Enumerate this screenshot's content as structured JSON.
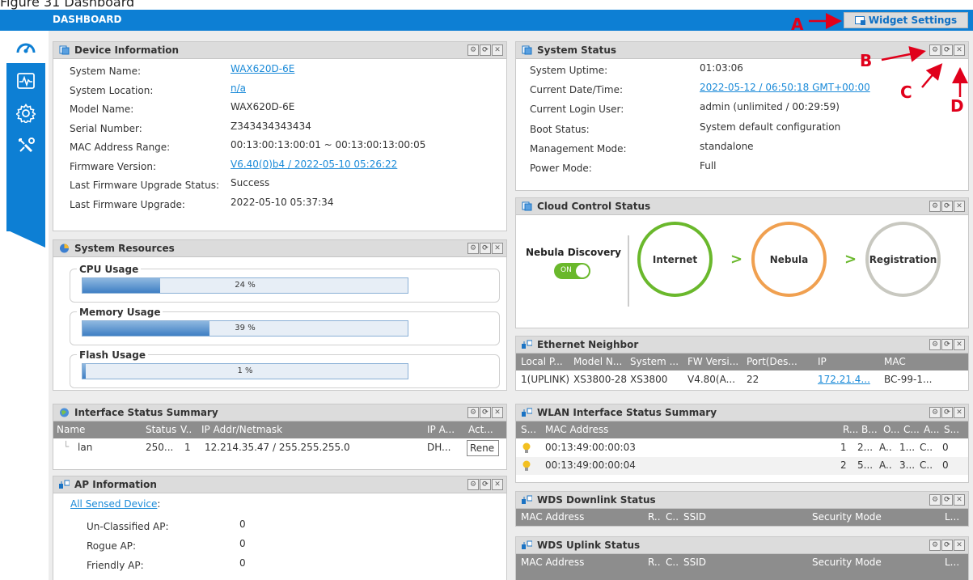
{
  "figure_caption": "Figure 31   Dashboard",
  "header": {
    "title": "DASHBOARD",
    "widget_settings": "Widget Settings"
  },
  "sidebar": {
    "items": [
      "dashboard-icon",
      "monitor-icon",
      "configuration-icon",
      "maintenance-icon"
    ]
  },
  "device_info": {
    "title": "Device Information",
    "rows": [
      {
        "label": "System Name:",
        "value": "WAX620D-6E",
        "link": true
      },
      {
        "label": "System Location:",
        "value": "n/a",
        "link": true
      },
      {
        "label": "Model Name:",
        "value": "WAX620D-6E",
        "link": false
      },
      {
        "label": "Serial Number:",
        "value": "Z343434343434",
        "link": false
      },
      {
        "label": "MAC Address Range:",
        "value": "00:13:00:13:00:01 ~ 00:13:00:13:00:05",
        "link": false
      },
      {
        "label": "Firmware Version:",
        "value": "V6.40(0)b4 / 2022-05-10 05:26:22",
        "link": true
      },
      {
        "label": "Last Firmware Upgrade Status:",
        "value": "Success",
        "link": false
      },
      {
        "label": "Last Firmware Upgrade:",
        "value": "2022-05-10 05:37:34",
        "link": false
      }
    ]
  },
  "system_resources": {
    "title": "System Resources",
    "bars": [
      {
        "label": "CPU Usage",
        "value": 24,
        "text": "24 %"
      },
      {
        "label": "Memory Usage",
        "value": 39,
        "text": "39 %"
      },
      {
        "label": "Flash Usage",
        "value": 1,
        "text": "1 %"
      }
    ]
  },
  "interface_status": {
    "title": "Interface Status Summary",
    "headers": [
      "Name",
      "Status",
      "V..",
      "IP Addr/Netmask",
      "IP A...",
      "Act..."
    ],
    "rows": [
      [
        "lan",
        "250...",
        "1",
        "12.214.35.47 / 255.255.255.0",
        "DH...",
        "Rene"
      ]
    ]
  },
  "ap_info": {
    "title": "AP Information",
    "link": "All Sensed Device",
    "link_suffix": ":",
    "rows": [
      {
        "label": "Un-Classified AP:",
        "value": "0"
      },
      {
        "label": "Rogue AP:",
        "value": "0"
      },
      {
        "label": "Friendly AP:",
        "value": "0"
      }
    ]
  },
  "system_status": {
    "title": "System Status",
    "rows": [
      {
        "label": "System Uptime:",
        "value": "01:03:06",
        "link": false
      },
      {
        "label": "Current Date/Time:",
        "value": "2022-05-12 / 06:50:18 GMT+00:00",
        "link": true
      },
      {
        "label": "Current Login User:",
        "value": "admin (unlimited / 00:29:59)",
        "link": false
      },
      {
        "label": "Boot Status:",
        "value": "System default configuration",
        "link": false
      },
      {
        "label": "Management Mode:",
        "value": "standalone",
        "link": false
      },
      {
        "label": "Power Mode:",
        "value": "Full",
        "link": false
      }
    ]
  },
  "cloud": {
    "title": "Cloud Control Status",
    "discovery": "Nebula Discovery",
    "toggle": "ON",
    "steps": [
      "Internet",
      "Nebula",
      "Registration"
    ],
    "arrow": ">"
  },
  "eth_neighbor": {
    "title": "Ethernet Neighbor",
    "headers": [
      "Local P...",
      "Model N...",
      "System ...",
      "FW Versi...",
      "Port(Des...",
      "IP",
      "MAC"
    ],
    "rows": [
      [
        "1(UPLINK)",
        "XS3800-28",
        "XS3800",
        "V4.80(A...",
        "22",
        "172.21.4...",
        "BC-99-1..."
      ]
    ]
  },
  "wlan": {
    "title": "WLAN Interface Status Summary",
    "headers": [
      "S...",
      "MAC Address",
      "R...",
      "B...",
      "O...",
      "C...",
      "A...",
      "S..."
    ],
    "rows": [
      [
        "00:13:49:00:00:03",
        "1",
        "2...",
        "A..",
        "1...",
        "C..",
        "0"
      ],
      [
        "00:13:49:00:00:04",
        "2",
        "5...",
        "A..",
        "3...",
        "C..",
        "0"
      ]
    ]
  },
  "wds_down": {
    "title": "WDS Downlink Status",
    "headers": [
      "MAC Address",
      "R..",
      "C..",
      "SSID",
      "Security Mode",
      "L..."
    ]
  },
  "wds_up": {
    "title": "WDS Uplink Status",
    "headers": [
      "MAC Address",
      "R..",
      "C..",
      "SSID",
      "Security Mode",
      "L..."
    ]
  },
  "annotations": {
    "a": "A",
    "b": "B",
    "c": "C",
    "d": "D"
  },
  "colors": {
    "brand_blue": "#0d7fd4",
    "header_gray": "#dcdcdc",
    "table_head": "#8d8d8d",
    "link": "#1a8ad8",
    "annotation_red": "#e0001b",
    "green": "#6ab82c",
    "orange": "#f0a050"
  }
}
